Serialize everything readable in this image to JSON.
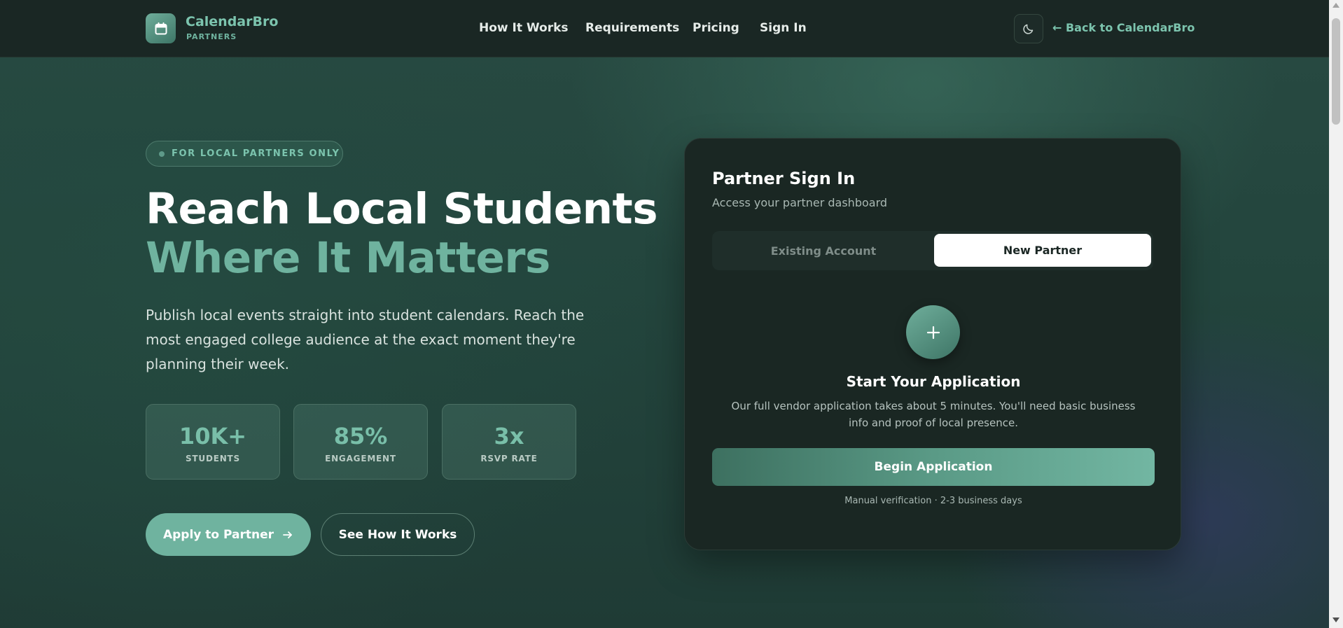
{
  "header": {
    "brand_name": "CalendarBro",
    "brand_sub": "PARTNERS",
    "nav": [
      "How It Works",
      "Requirements",
      "Pricing",
      "Sign In"
    ],
    "back_link": "← Back to CalendarBro"
  },
  "hero": {
    "badge": "FOR LOCAL PARTNERS ONLY",
    "title_line1": "Reach Local Students",
    "title_line2": "Where It Matters",
    "lead": "Publish local events straight into student calendars. Reach the most engaged college audience at the exact moment they're planning their week.",
    "stats": [
      {
        "value": "10K+",
        "label": "STUDENTS"
      },
      {
        "value": "85%",
        "label": "ENGAGEMENT"
      },
      {
        "value": "3x",
        "label": "RSVP RATE"
      }
    ],
    "apply_button": "Apply to Partner",
    "how_button": "See How It Works"
  },
  "card": {
    "title": "Partner Sign In",
    "subtitle": "Access your partner dashboard",
    "tabs": [
      "Existing Account",
      "New Partner"
    ],
    "active_tab": "New Partner",
    "start_title": "Start Your Application",
    "start_desc": "Our full vendor application takes about 5 minutes. You'll need basic business info and proof of local presence.",
    "begin_button": "Begin Application",
    "note": "Manual verification · 2-3 business days"
  },
  "colors": {
    "accent": "#6fb39f",
    "header_bg": "#1a2724",
    "card_bg": "#1a2723"
  },
  "icons": {
    "logo": "calendar-icon",
    "theme": "moon-icon",
    "apply": "arrow-right-icon",
    "start": "plus-icon"
  }
}
